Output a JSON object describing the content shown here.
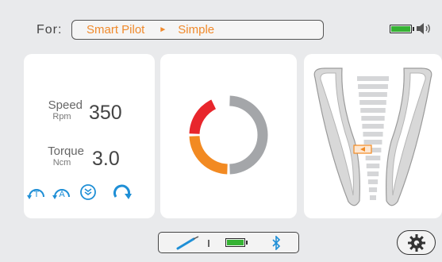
{
  "header": {
    "for_label": "For:",
    "mode_primary": "Smart Pilot",
    "mode_separator": "►",
    "mode_secondary": "Simple"
  },
  "params": {
    "speed_label": "Speed",
    "speed_unit": "Rpm",
    "speed_value": "350",
    "torque_label": "Torque",
    "torque_unit": "Ncm",
    "torque_value": "3.0"
  },
  "mode_icons": [
    "torque-mode-icon",
    "auto-mode-icon",
    "auto-down-icon",
    "rotation-direction-icon"
  ],
  "gauge": {
    "level_fraction": 0.5,
    "colors": {
      "red": "#e8262c",
      "orange": "#f28a22",
      "gray": "#a4a6a9"
    }
  },
  "status": {
    "battery_level": 1.0,
    "battery_color": "#35b233",
    "bluetooth_color": "#1f8fd6",
    "handpiece_color": "#1f8fd6"
  },
  "colors": {
    "accent": "#f08a2c",
    "background": "#e9eaec"
  }
}
